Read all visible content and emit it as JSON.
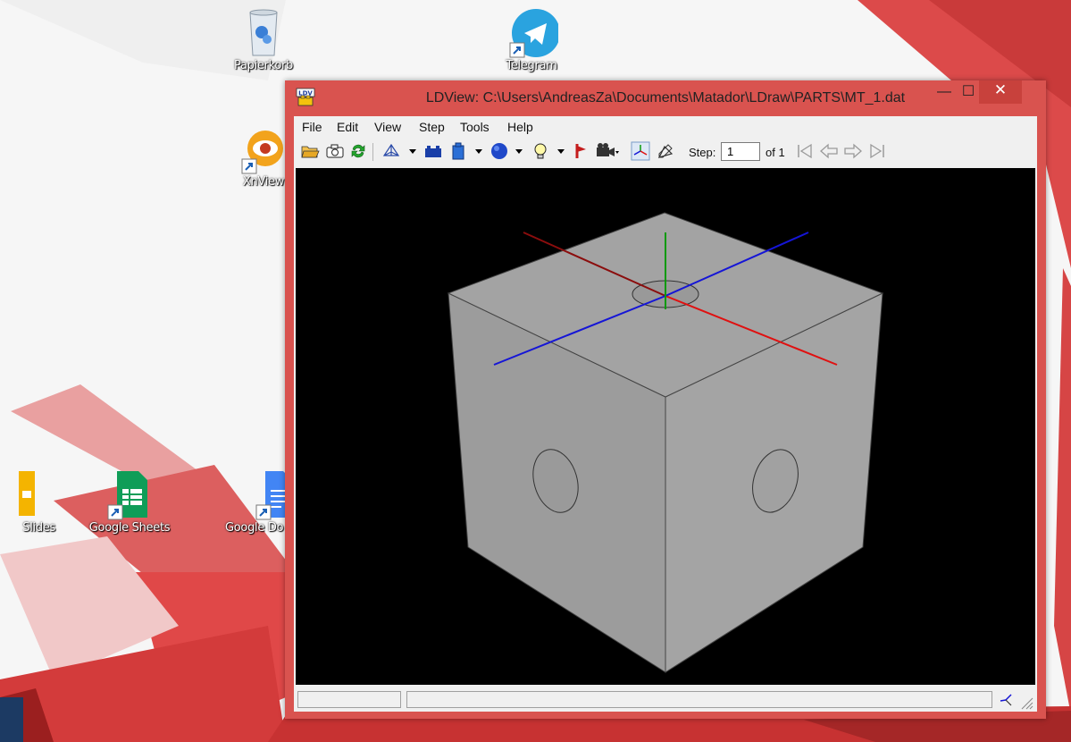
{
  "desktop": {
    "icons": [
      {
        "name": "recycle-bin",
        "label": "Papierkorb"
      },
      {
        "name": "telegram",
        "label": "Telegram"
      },
      {
        "name": "xnview",
        "label": "XnView"
      },
      {
        "name": "google-slides",
        "label": "Slides"
      },
      {
        "name": "google-sheets",
        "label": "Google Sheets"
      },
      {
        "name": "google-docs",
        "label": "Google Do"
      }
    ]
  },
  "window": {
    "title": "LDView: C:\\Users\\AndreasZa\\Documents\\Matador\\LDraw\\PARTS\\MT_1.dat",
    "app_icon": "LDV",
    "controls": {
      "minimize": "—",
      "maximize": "☐",
      "close": "✕"
    }
  },
  "menu": [
    "File",
    "Edit",
    "View",
    "Step",
    "Tools",
    "Help"
  ],
  "toolbar": {
    "icons": [
      "open-folder-icon",
      "camera-icon",
      "reload-icon",
      "wireframe-icon",
      "bricks-icon",
      "brick-icon",
      "sphere-icon",
      "lightbulb-icon",
      "bfc-icon",
      "camera-view-icon",
      "axes-icon",
      "examine-icon"
    ],
    "step_label": "Step:",
    "step_value": "1",
    "step_of": "of 1",
    "nav_icons": [
      "first-step-icon",
      "prev-step-icon",
      "next-step-icon",
      "last-step-icon"
    ]
  },
  "viewport": {
    "background": "#000000",
    "model": "MT_1.dat",
    "colors": {
      "top": "#a3a3a3",
      "left": "#9c9c9c",
      "right": "#a4a4a4",
      "x_axis": "#e01010",
      "y_axis": "#0a9a0a",
      "z_axis": "#1515d6"
    }
  },
  "colors": {
    "window_frame": "#d9534f",
    "close_button": "#c8413c",
    "chrome": "#f0f0f0"
  }
}
